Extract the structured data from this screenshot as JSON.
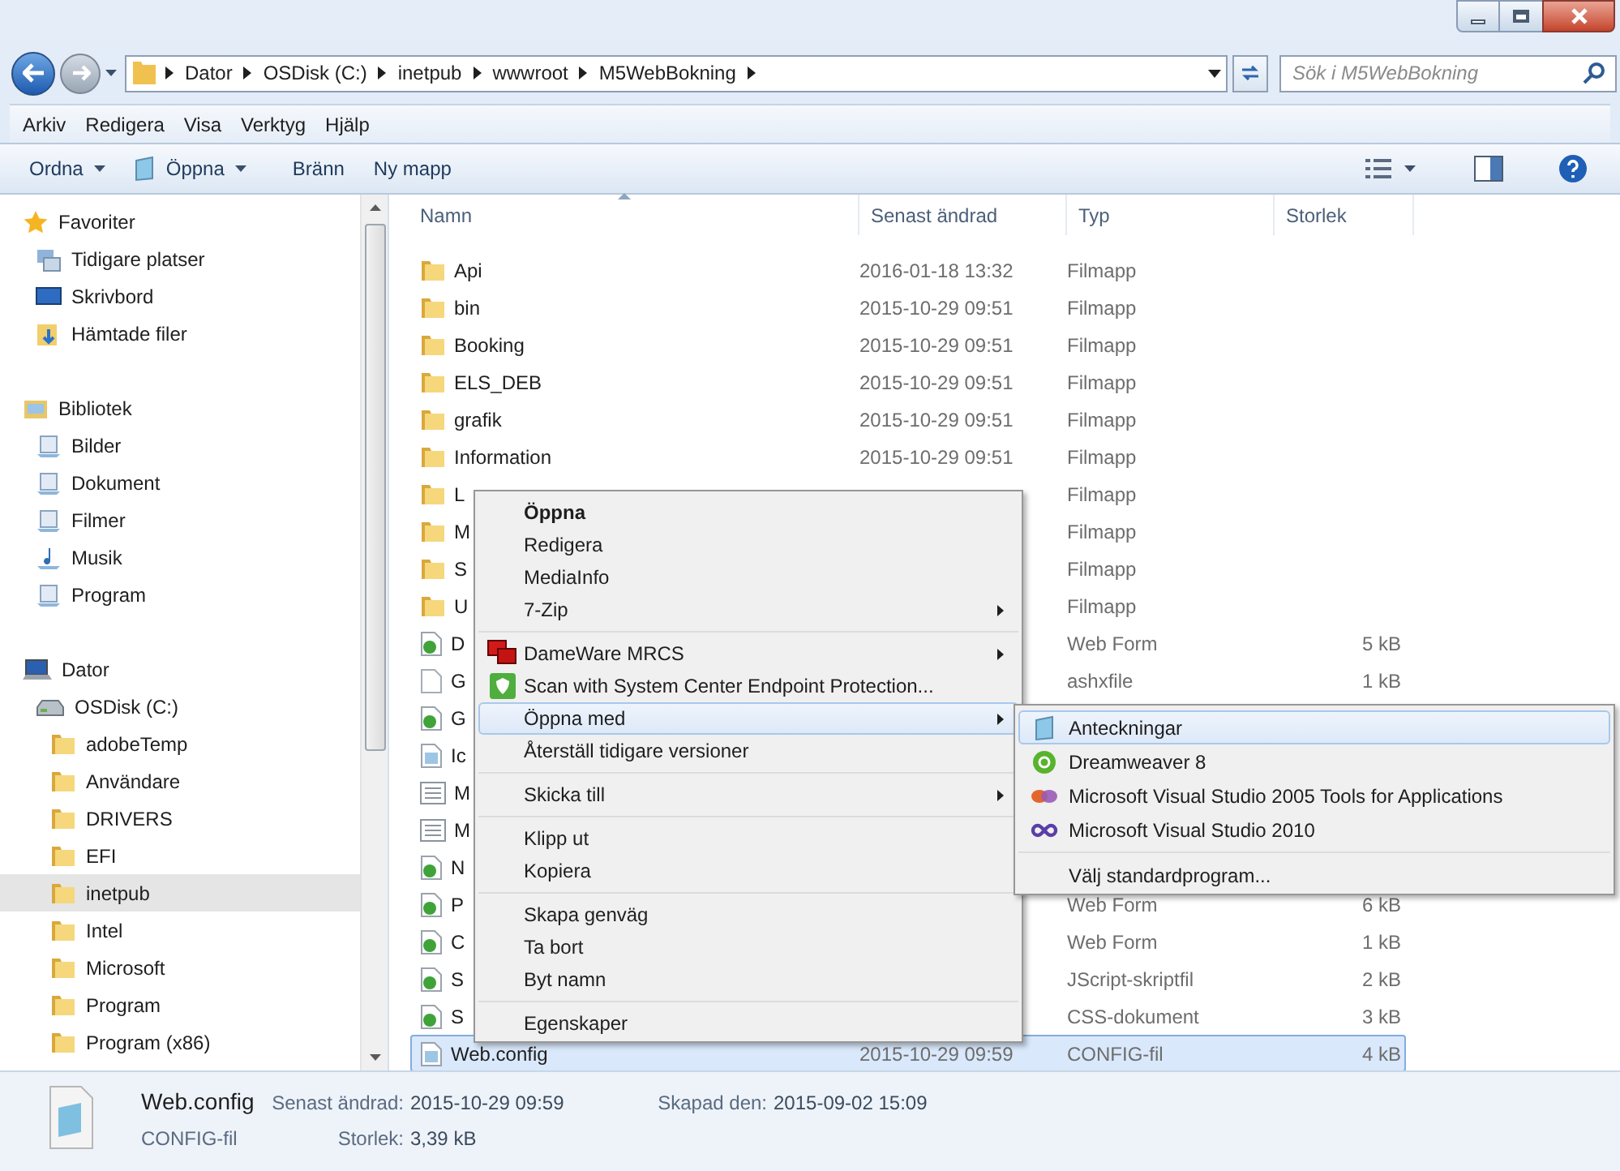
{
  "address_bar": {
    "crumbs": [
      "Dator",
      "OSDisk (C:)",
      "inetpub",
      "wwwroot",
      "M5WebBokning"
    ],
    "search_placeholder": "Sök i M5WebBokning"
  },
  "menu_bar": [
    "Arkiv",
    "Redigera",
    "Visa",
    "Verktyg",
    "Hjälp"
  ],
  "toolbar": [
    {
      "label": "Ordna",
      "kind": "menu"
    },
    {
      "label": "Öppna",
      "kind": "open"
    },
    {
      "label": "Bränn",
      "kind": "plain"
    },
    {
      "label": "Ny mapp",
      "kind": "plain"
    }
  ],
  "columns": [
    {
      "label": "Namn",
      "sorted": true
    },
    {
      "label": "Senast ändrad",
      "sorted": false
    },
    {
      "label": "Typ",
      "sorted": false
    },
    {
      "label": "Storlek",
      "sorted": false
    }
  ],
  "navigation": [
    {
      "label": "Favoriter",
      "kind": "star",
      "selected": false,
      "children": [
        {
          "label": "Tidigare platser",
          "kind": "recent",
          "selected": false
        },
        {
          "label": "Skrivbord",
          "kind": "desktop",
          "selected": false
        },
        {
          "label": "Hämtade filer",
          "kind": "download",
          "selected": false
        }
      ]
    },
    {
      "label": "Bibliotek",
      "kind": "library",
      "selected": false,
      "children": [
        {
          "label": "Bilder",
          "kind": "lib",
          "selected": false
        },
        {
          "label": "Dokument",
          "kind": "lib",
          "selected": false
        },
        {
          "label": "Filmer",
          "kind": "lib",
          "selected": false
        },
        {
          "label": "Musik",
          "kind": "music",
          "selected": false
        },
        {
          "label": "Program",
          "kind": "lib",
          "selected": false
        }
      ]
    },
    {
      "label": "Dator",
      "kind": "computer",
      "selected": false,
      "children": [
        {
          "label": "OSDisk (C:)",
          "kind": "drive",
          "selected": false,
          "children": [
            {
              "label": "adobeTemp",
              "kind": "folder",
              "selected": false
            },
            {
              "label": "Användare",
              "kind": "folder",
              "selected": false
            },
            {
              "label": "DRIVERS",
              "kind": "folder",
              "selected": false
            },
            {
              "label": "EFI",
              "kind": "folder",
              "selected": false
            },
            {
              "label": "inetpub",
              "kind": "folder",
              "selected": true
            },
            {
              "label": "Intel",
              "kind": "folder",
              "selected": false
            },
            {
              "label": "Microsoft",
              "kind": "folder",
              "selected": false
            },
            {
              "label": "Program",
              "kind": "folder",
              "selected": false
            },
            {
              "label": "Program (x86)",
              "kind": "folder",
              "selected": false
            }
          ]
        }
      ]
    }
  ],
  "files": [
    {
      "name": "Api",
      "modified": "2016-01-18 13:32",
      "type": "Filmapp",
      "kind": "folder",
      "selected": false
    },
    {
      "name": "bin",
      "modified": "2015-10-29 09:51",
      "type": "Filmapp",
      "kind": "folder",
      "selected": false
    },
    {
      "name": "Booking",
      "modified": "2015-10-29 09:51",
      "type": "Filmapp",
      "kind": "folder",
      "selected": false
    },
    {
      "name": "ELS_DEB",
      "modified": "2015-10-29 09:51",
      "type": "Filmapp",
      "kind": "folder",
      "selected": false
    },
    {
      "name": "grafik",
      "modified": "2015-10-29 09:51",
      "type": "Filmapp",
      "kind": "folder",
      "selected": false
    },
    {
      "name": "Information",
      "modified": "2015-10-29 09:51",
      "type": "Filmapp",
      "kind": "folder",
      "selected": false
    },
    {
      "name": "L",
      "type": "Filmapp",
      "kind": "folder",
      "selected": false
    },
    {
      "name": "M",
      "type": "Filmapp",
      "kind": "folder",
      "selected": false
    },
    {
      "name": "S",
      "type": "Filmapp",
      "kind": "folder",
      "selected": false
    },
    {
      "name": "U",
      "type": "Filmapp",
      "kind": "folder",
      "selected": false
    },
    {
      "name": "D",
      "type": "Web Form",
      "size": "5 kB",
      "kind": "aspx",
      "selected": false
    },
    {
      "name": "G",
      "type": "ashxfile",
      "size": "1 kB",
      "kind": "blank",
      "selected": false
    },
    {
      "name": "G",
      "kind": "aspx",
      "selected": false
    },
    {
      "name": "Ic",
      "kind": "text",
      "selected": false
    },
    {
      "name": "M",
      "kind": "list",
      "selected": false
    },
    {
      "name": "M",
      "kind": "list",
      "selected": false
    },
    {
      "name": "N",
      "kind": "aspx",
      "selected": false
    },
    {
      "name": "P",
      "type": "Web Form",
      "size": "6 kB",
      "kind": "aspx",
      "selected": false
    },
    {
      "name": "C",
      "type": "Web Form",
      "size": "1 kB",
      "kind": "aspx",
      "selected": false
    },
    {
      "name": "S",
      "type": "JScript-skriptfil",
      "size": "2 kB",
      "kind": "aspx",
      "selected": false
    },
    {
      "name": "S",
      "type": "CSS-dokument",
      "size": "3 kB",
      "kind": "aspx",
      "selected": false
    },
    {
      "name": "Web.config",
      "modified": "2015-10-29 09:59",
      "type": "CONFIG-fil",
      "size": "4 kB",
      "kind": "text",
      "selected": true
    }
  ],
  "context_menu": {
    "groups": [
      [
        {
          "label": "Öppna",
          "kind": "plain",
          "default": true,
          "submenu": false,
          "selected": false
        },
        {
          "label": "Redigera",
          "kind": "plain",
          "default": false,
          "submenu": false,
          "selected": false
        },
        {
          "label": "MediaInfo",
          "kind": "plain",
          "default": false,
          "submenu": false,
          "selected": false
        },
        {
          "label": "7-Zip",
          "kind": "plain",
          "default": false,
          "submenu": true,
          "selected": false
        }
      ],
      [
        {
          "label": "DameWare MRCS",
          "kind": "screens",
          "default": false,
          "submenu": true,
          "selected": false
        },
        {
          "label": "Scan with System Center Endpoint Protection...",
          "kind": "shield",
          "default": false,
          "submenu": false,
          "selected": false
        },
        {
          "label": "Öppna med",
          "kind": "plain",
          "default": false,
          "submenu": true,
          "selected": true
        },
        {
          "label": "Återställ tidigare versioner",
          "kind": "plain",
          "default": false,
          "submenu": false,
          "selected": false
        }
      ],
      [
        {
          "label": "Skicka till",
          "kind": "plain",
          "default": false,
          "submenu": true,
          "selected": false
        }
      ],
      [
        {
          "label": "Klipp ut",
          "kind": "plain",
          "default": false,
          "submenu": false,
          "selected": false
        },
        {
          "label": "Kopiera",
          "kind": "plain",
          "default": false,
          "submenu": false,
          "selected": false
        }
      ],
      [
        {
          "label": "Skapa genväg",
          "kind": "plain",
          "default": false,
          "submenu": false,
          "selected": false
        },
        {
          "label": "Ta bort",
          "kind": "plain",
          "default": false,
          "submenu": false,
          "selected": false
        },
        {
          "label": "Byt namn",
          "kind": "plain",
          "default": false,
          "submenu": false,
          "selected": false
        }
      ],
      [
        {
          "label": "Egenskaper",
          "kind": "plain",
          "default": false,
          "submenu": false,
          "selected": false
        }
      ]
    ]
  },
  "open_with_menu": {
    "groups": [
      [
        {
          "label": "Anteckningar",
          "kind": "notepad",
          "selected": true
        },
        {
          "label": "Dreamweaver 8",
          "kind": "ring",
          "selected": false
        },
        {
          "label": "Microsoft Visual Studio 2005 Tools for Applications",
          "kind": "swirl",
          "selected": false
        },
        {
          "label": "Microsoft Visual Studio 2010",
          "kind": "infinity",
          "selected": false
        }
      ],
      [
        {
          "label": "Välj standardprogram...",
          "kind": "plain",
          "selected": false
        }
      ]
    ]
  },
  "details": {
    "name": "Web.config",
    "type": "CONFIG-fil",
    "fields": [
      {
        "label": "Senast ändrad:",
        "value": "2015-10-29 09:59"
      },
      {
        "label": "Skapad den:",
        "value": "2015-09-02 15:09"
      },
      {
        "label": "Storlek:",
        "value": "3,39 kB"
      }
    ]
  }
}
